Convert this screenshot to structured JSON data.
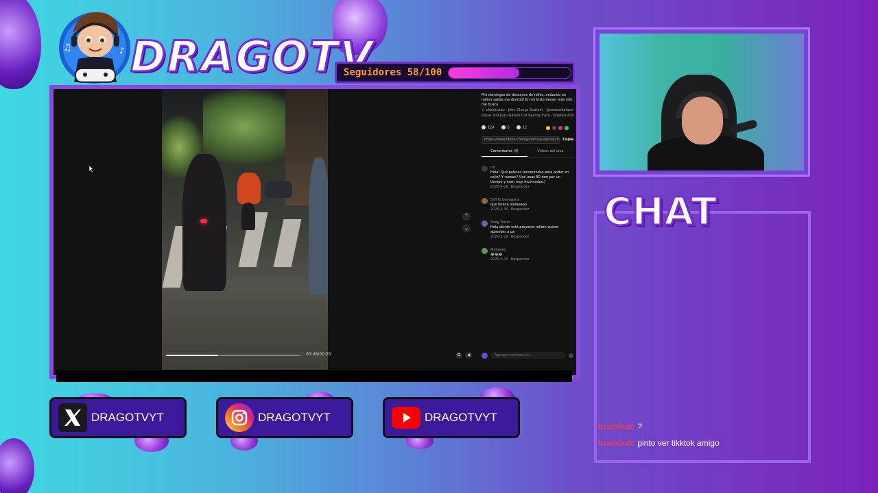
{
  "brand": {
    "title": "DRAGOTV"
  },
  "followers": {
    "label": "Seguidores 58/100",
    "current": 58,
    "goal": 100,
    "progress_fraction": 0.58
  },
  "tiktok_player": {
    "time": "00:06/00:20",
    "progress_fraction": 0.39,
    "description": "Mis domingos de descanso de rolles, andando en rollers salida me divirtió! En mi insta tienen más info me busca",
    "music_line": "♫ sikeakusdu - John (Songs Station) - @sarmeikafacmobile",
    "sound_line": "Oscar and Juan Gálvez Car Racing Track - Buenos Aires",
    "stats": {
      "likes": "124",
      "comments": "6",
      "saves": "12"
    },
    "link": "https://www.tiktok.com/@martina.dance/video/75...",
    "copy_label": "Copia",
    "tabs": [
      "Comentarios (4)",
      "Videos del crea"
    ],
    "comments": [
      {
        "user": "rnr",
        "text": "Hola! Qué patines recomendas para andar en calle? Y ruedas? Usé unas 80 mm por un tiempo y eran muy incómodas:)",
        "date": "2025-4-26",
        "reply": "Responder",
        "avatar_color": "#3a3a3a"
      },
      {
        "user": "DeYTo Gavagana",
        "text": "que buena ondaaaaa",
        "date": "2025-4-30",
        "reply": "Responder",
        "avatar_color": "#8a6a4a"
      },
      {
        "user": "Andy Torres",
        "text": "Hola dónde está proyecto rollers quiero aprender a pa",
        "date": "2025-5-20",
        "reply": "Responder",
        "avatar_color": "#6a6aa0"
      },
      {
        "user": "Matiassg",
        "text": "😂😂😂",
        "date": "2025-6-30",
        "reply": "Responder",
        "avatar_color": "#5a9a4a"
      }
    ],
    "comment_placeholder": "Agregar comentario..."
  },
  "socials": [
    {
      "platform": "x",
      "icon": "x-icon",
      "label": "DRAGOTVYT",
      "color": "#1a1a1a"
    },
    {
      "platform": "instagram",
      "icon": "instagram-icon",
      "label": "DRAGOTVYT",
      "color": "#d6336c"
    },
    {
      "platform": "youtube",
      "icon": "youtube-icon",
      "label": "DRAGOTVYT",
      "color": "#ff0000"
    }
  ],
  "chat": {
    "title": "CHAT",
    "messages": [
      {
        "user": "bramlxdc",
        "text": "?"
      },
      {
        "user": "bramlxdc",
        "text": "pinto ver tikktok amigo"
      }
    ]
  }
}
